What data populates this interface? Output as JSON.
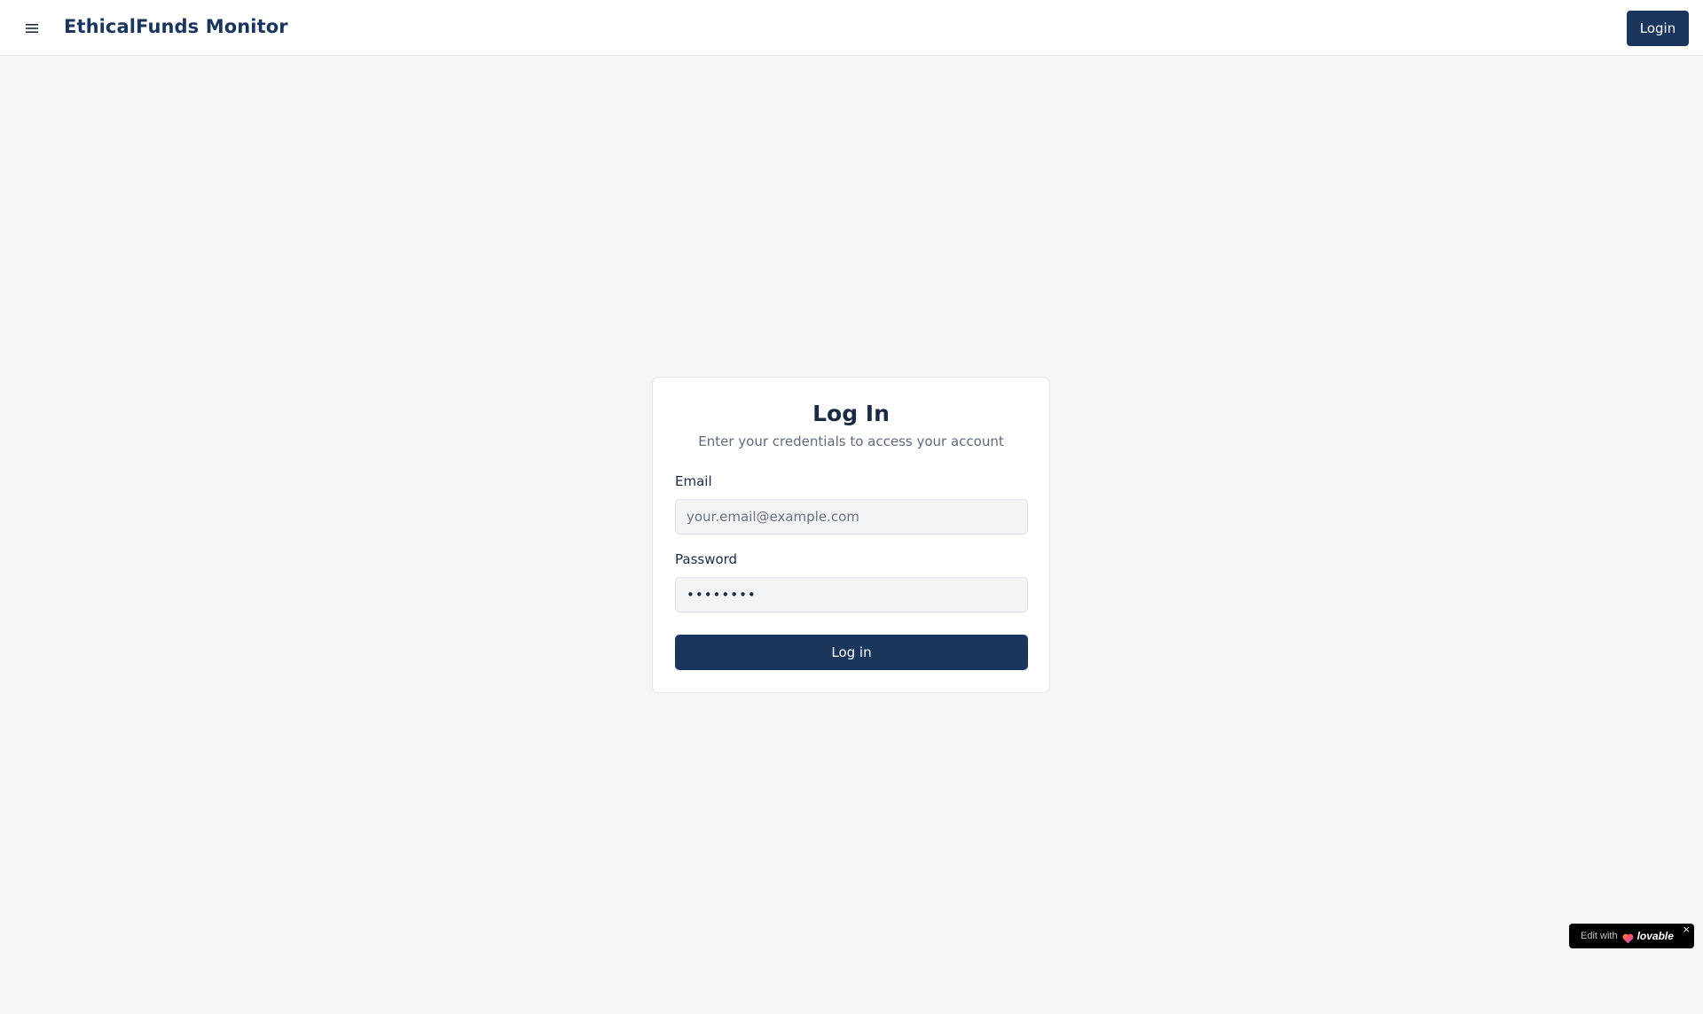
{
  "header": {
    "menu_icon": "hamburger-menu-icon",
    "app_title": "EthicalFunds Monitor",
    "login_label": "Login"
  },
  "login_card": {
    "title": "Log In",
    "subtitle": "Enter your credentials to access your account",
    "email": {
      "label": "Email",
      "placeholder": "your.email@example.com",
      "value": ""
    },
    "password": {
      "label": "Password",
      "value": "••••••••"
    },
    "submit_label": "Log in"
  },
  "badge": {
    "prefix": "Edit with",
    "brand": "lovable",
    "close": "×",
    "heart_icon": "lovable-heart-icon"
  },
  "colors": {
    "primary": "#1b365d",
    "background": "#f5f6f8",
    "card": "#ffffff",
    "input_bg": "#f3f4f6"
  }
}
